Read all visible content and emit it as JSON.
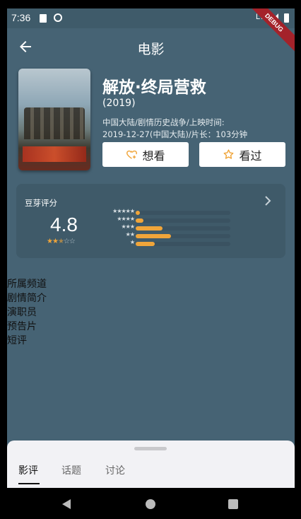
{
  "status_bar": {
    "time": "7:36",
    "network": "LTE",
    "debug_label": "DEBUG"
  },
  "app_bar": {
    "title": "电影"
  },
  "movie": {
    "title": "解放·终局营救",
    "year": "(2019)",
    "info_line1": "中国大陆/剧情历史战争/上映时间:",
    "info_line2": "2019-12-27(中国大陆)/片长：103分钟"
  },
  "buttons": {
    "want": "想看",
    "seen": "看过"
  },
  "rating": {
    "label": "豆芽评分",
    "score": "4.8",
    "stars_filled": 2.5,
    "stars_total": 5,
    "distribution": [
      {
        "stars": "★★★★★",
        "fraction": 0.04
      },
      {
        "stars": "★★★★",
        "fraction": 0.08
      },
      {
        "stars": "★★★",
        "fraction": 0.28
      },
      {
        "stars": "★★",
        "fraction": 0.37
      },
      {
        "stars": "★",
        "fraction": 0.2
      }
    ]
  },
  "sections": [
    "所属频道",
    "剧情简介",
    "演职员",
    "预告片",
    "短评"
  ],
  "tabs": [
    {
      "label": "影评",
      "active": true
    },
    {
      "label": "话题",
      "active": false
    },
    {
      "label": "讨论",
      "active": false
    }
  ],
  "colors": {
    "background": "#466374",
    "accent": "#f0a53a",
    "sheet": "#f2f2f5"
  },
  "icons": {
    "back": "arrow-left-icon",
    "want": "heart-plus-icon",
    "seen": "star-outline-icon",
    "chevron": "chevron-right-icon"
  }
}
